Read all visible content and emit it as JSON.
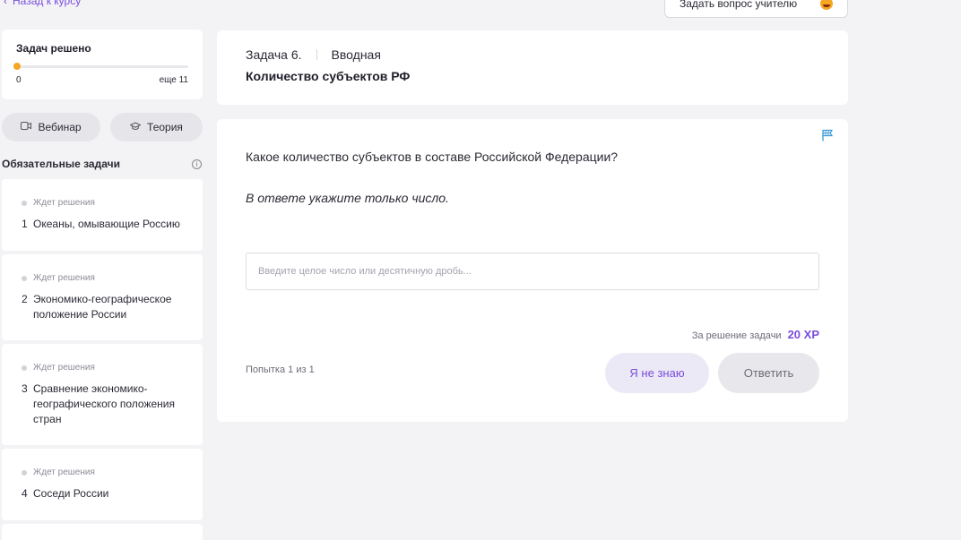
{
  "nav": {
    "back_label": "Назад к курсу"
  },
  "ask": {
    "label": "Задать вопрос учителю"
  },
  "progress": {
    "title": "Задач решено",
    "solved": "0",
    "remaining": "еще 11"
  },
  "buttons": {
    "webinar": "Вебинар",
    "theory": "Теория"
  },
  "sidebar": {
    "section_title": "Обязательные задачи",
    "tasks": [
      {
        "status": "Ждет решения",
        "number": "1",
        "title": "Океаны, омывающие Россию"
      },
      {
        "status": "Ждет решения",
        "number": "2",
        "title": "Экономико-географическое положение России"
      },
      {
        "status": "Ждет решения",
        "number": "3",
        "title": "Сравнение экономико-географического положения стран"
      },
      {
        "status": "Ждет решения",
        "number": "4",
        "title": "Соседи России"
      }
    ]
  },
  "task": {
    "number_label": "Задача 6.",
    "type": "Вводная",
    "title": "Количество субъектов РФ",
    "question": "Какое количество субъектов в составе Российской Федерации?",
    "hint": "В ответе укажите только число.",
    "input_placeholder": "Введите целое число или десятичную дробь...",
    "xp_label": "За решение задачи",
    "xp_value": "20 XP",
    "attempt": "Попытка 1 из 1",
    "dont_know_label": "Я не знаю",
    "answer_label": "Ответить"
  },
  "colors": {
    "accent": "#7a4dde",
    "flag": "#3a9ad9",
    "progress_dot": "#f5a623"
  }
}
